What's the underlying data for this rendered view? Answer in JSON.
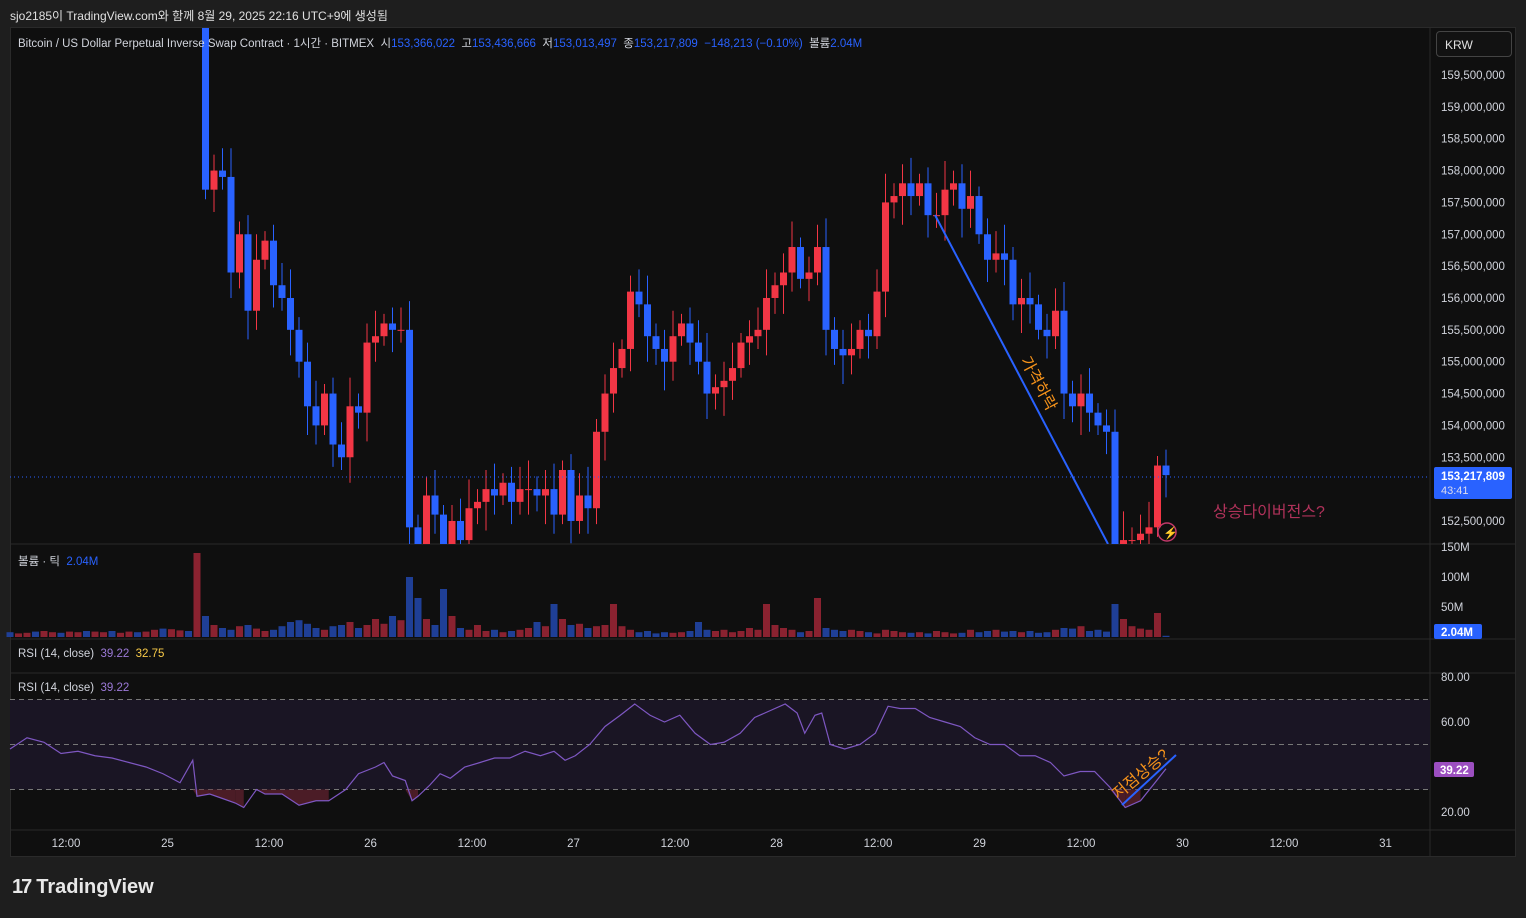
{
  "credit": "sjo2185이 TradingView.com와 함께 8월 29, 2025 22:16 UTC+9에 생성됨",
  "legend": {
    "symbol": "Bitcoin / US Dollar Perpetual Inverse Swap Contract · 1시간 · BITMEX",
    "o_label": "시",
    "o": "153,366,022",
    "h_label": "고",
    "h": "153,436,666",
    "l_label": "저",
    "l": "153,013,497",
    "c_label": "종",
    "c": "153,217,809",
    "change": "−148,213 (−0.10%)",
    "vol_label": "볼륨",
    "vol": "2.04M"
  },
  "currency": "KRW",
  "volume_legend": {
    "label": "볼륨 · 틱",
    "value": "2.04M"
  },
  "rsi1_legend": {
    "label": "RSI (14, close)",
    "v1": "39.22",
    "v2": "32.75"
  },
  "rsi2_legend": {
    "label": "RSI (14, close)",
    "v1": "39.22"
  },
  "price_axis": [
    "159,500,000",
    "159,000,000",
    "158,500,000",
    "158,000,000",
    "157,500,000",
    "157,000,000",
    "156,500,000",
    "156,000,000",
    "155,500,000",
    "155,000,000",
    "154,500,000",
    "154,000,000",
    "153,500,000",
    "152,500,000"
  ],
  "price_badge": {
    "price": "153,217,809",
    "countdown": "43:41"
  },
  "volume_axis": [
    "150M",
    "100M",
    "50M"
  ],
  "volume_badge": "2.04M",
  "rsi_axis": [
    "80.00",
    "60.00",
    "20.00"
  ],
  "rsi_badge": "39.22",
  "time_axis": [
    "12:00",
    "25",
    "12:00",
    "26",
    "12:00",
    "27",
    "12:00",
    "28",
    "12:00",
    "29",
    "12:00",
    "30",
    "12:00",
    "31"
  ],
  "annotations": {
    "drop": "가격하락",
    "divergence": "상승다이버전스?",
    "higher_low": "저점상승?"
  },
  "brand": "TradingView",
  "colors": {
    "up": "#f23645",
    "down": "#2962ff",
    "rsi": "#7e57c2",
    "annotation": "#f7931a",
    "divergence": "#b0325a"
  },
  "chart_data": {
    "type": "candlestick",
    "units": "millions KRW",
    "first_candle_hour": 23,
    "closes": [
      157.7,
      158.0,
      157.9,
      156.4,
      157.0,
      155.8,
      156.6,
      156.9,
      156.2,
      156.0,
      155.5,
      155.0,
      154.3,
      154.0,
      154.5,
      153.7,
      153.5,
      154.3,
      154.2,
      155.3,
      155.4,
      155.6,
      155.5,
      155.5,
      152.4,
      152.1,
      152.9,
      152.6,
      152.0,
      152.5,
      152.2,
      152.7,
      152.8,
      153.0,
      152.9,
      153.1,
      152.8,
      153.0,
      153.0,
      152.9,
      153.0,
      152.6,
      153.3,
      152.5,
      152.9,
      152.7,
      153.9,
      154.5,
      154.9,
      155.2,
      156.1,
      155.9,
      155.4,
      155.2,
      155.0,
      155.4,
      155.6,
      155.3,
      155.0,
      154.5,
      154.6,
      154.7,
      154.9,
      155.3,
      155.4,
      155.5,
      156.0,
      156.2,
      156.4,
      156.8,
      156.3,
      156.4,
      156.8,
      155.5,
      155.2,
      155.1,
      155.2,
      155.5,
      155.4,
      156.1,
      157.5,
      157.6,
      157.8,
      157.6,
      157.8,
      157.3,
      157.3,
      157.7,
      157.8,
      157.4,
      157.6,
      157.0,
      156.6,
      156.7,
      156.6,
      155.9,
      156.0,
      155.9,
      155.5,
      155.4,
      155.8,
      154.5,
      154.3,
      154.5,
      154.2,
      154.0,
      153.9,
      152.1,
      152.2,
      152.2,
      152.3,
      152.4,
      153.37,
      153.22
    ],
    "first_open": 160.5,
    "volume_m": [
      8,
      6,
      7,
      9,
      10,
      8,
      7,
      9,
      8,
      10,
      9,
      8,
      10,
      7,
      9,
      8,
      9,
      12,
      14,
      13,
      11,
      10,
      140,
      35,
      20,
      15,
      12,
      18,
      20,
      14,
      10,
      12,
      18,
      25,
      28,
      22,
      15,
      12,
      18,
      20,
      25,
      15,
      20,
      30,
      22,
      35,
      28,
      100,
      65,
      30,
      20,
      80,
      35,
      15,
      12,
      20,
      10,
      12,
      8,
      10,
      12,
      15,
      25,
      18,
      55,
      30,
      20,
      22,
      15,
      18,
      20,
      55,
      18,
      12,
      8,
      10,
      6,
      8,
      7,
      8,
      10,
      25,
      12,
      10,
      12,
      8,
      10,
      15,
      12,
      55,
      20,
      15,
      12,
      8,
      10,
      65,
      15,
      12,
      10,
      12,
      10,
      8,
      6,
      12,
      10,
      8,
      7,
      8,
      6,
      10,
      8,
      6,
      7,
      12,
      8,
      10,
      12,
      9,
      10,
      8,
      10,
      7,
      8,
      12,
      15,
      14,
      18,
      10,
      12,
      9,
      55,
      30,
      18,
      14,
      12,
      40,
      2.04
    ],
    "rsi_points": [
      [
        0,
        48
      ],
      [
        2,
        53
      ],
      [
        4,
        51
      ],
      [
        6,
        46
      ],
      [
        8,
        47
      ],
      [
        10,
        45
      ],
      [
        12,
        44
      ],
      [
        14,
        42
      ],
      [
        16,
        40
      ],
      [
        18,
        37
      ],
      [
        20,
        33
      ],
      [
        21.5,
        43
      ],
      [
        22,
        27
      ],
      [
        23.5,
        28
      ],
      [
        25,
        26
      ],
      [
        26.5,
        24
      ],
      [
        27.5,
        22
      ],
      [
        29,
        30
      ],
      [
        30,
        28
      ],
      [
        32,
        28
      ],
      [
        34,
        23
      ],
      [
        36,
        25
      ],
      [
        37.5,
        25
      ],
      [
        39.5,
        30
      ],
      [
        41,
        37
      ],
      [
        43,
        40
      ],
      [
        44,
        42
      ],
      [
        45,
        36
      ],
      [
        46.5,
        34
      ],
      [
        47.3,
        25
      ],
      [
        48,
        27
      ],
      [
        49.4,
        32
      ],
      [
        50.6,
        37
      ],
      [
        51.8,
        35
      ],
      [
        53.5,
        40
      ],
      [
        55.3,
        42
      ],
      [
        57,
        44
      ],
      [
        58.8,
        44
      ],
      [
        60.6,
        47
      ],
      [
        62.4,
        45
      ],
      [
        64,
        47
      ],
      [
        65.3,
        43
      ],
      [
        66.5,
        45
      ],
      [
        68.2,
        50
      ],
      [
        70,
        58
      ],
      [
        71.8,
        63
      ],
      [
        73.5,
        68
      ],
      [
        75.3,
        63
      ],
      [
        77,
        60
      ],
      [
        78.8,
        63
      ],
      [
        80.6,
        55
      ],
      [
        82.4,
        50
      ],
      [
        84,
        51
      ],
      [
        85.9,
        55
      ],
      [
        87.6,
        62
      ],
      [
        89.4,
        65
      ],
      [
        91.2,
        68
      ],
      [
        92.6,
        64
      ],
      [
        93.5,
        55
      ],
      [
        94.7,
        63
      ],
      [
        95.5,
        64
      ],
      [
        96.5,
        50
      ],
      [
        98.2,
        48
      ],
      [
        100,
        50
      ],
      [
        101.8,
        55
      ],
      [
        103.3,
        67
      ],
      [
        104.7,
        66
      ],
      [
        106.5,
        66
      ],
      [
        108.2,
        62
      ],
      [
        110,
        60
      ],
      [
        111.8,
        58
      ],
      [
        113.5,
        53
      ],
      [
        115.3,
        50
      ],
      [
        117,
        50
      ],
      [
        118.8,
        45
      ],
      [
        120.6,
        45
      ],
      [
        122.4,
        42
      ],
      [
        124,
        36
      ],
      [
        125.9,
        38
      ],
      [
        127.6,
        38
      ],
      [
        129.4,
        31
      ],
      [
        131.2,
        22
      ],
      [
        133,
        25
      ],
      [
        134.7,
        33
      ],
      [
        136,
        39.22
      ]
    ],
    "rsi_levels": [
      70,
      50,
      30
    ],
    "price_range": [
      152.3,
      159.8
    ],
    "rsi_range": [
      15,
      82
    ]
  }
}
